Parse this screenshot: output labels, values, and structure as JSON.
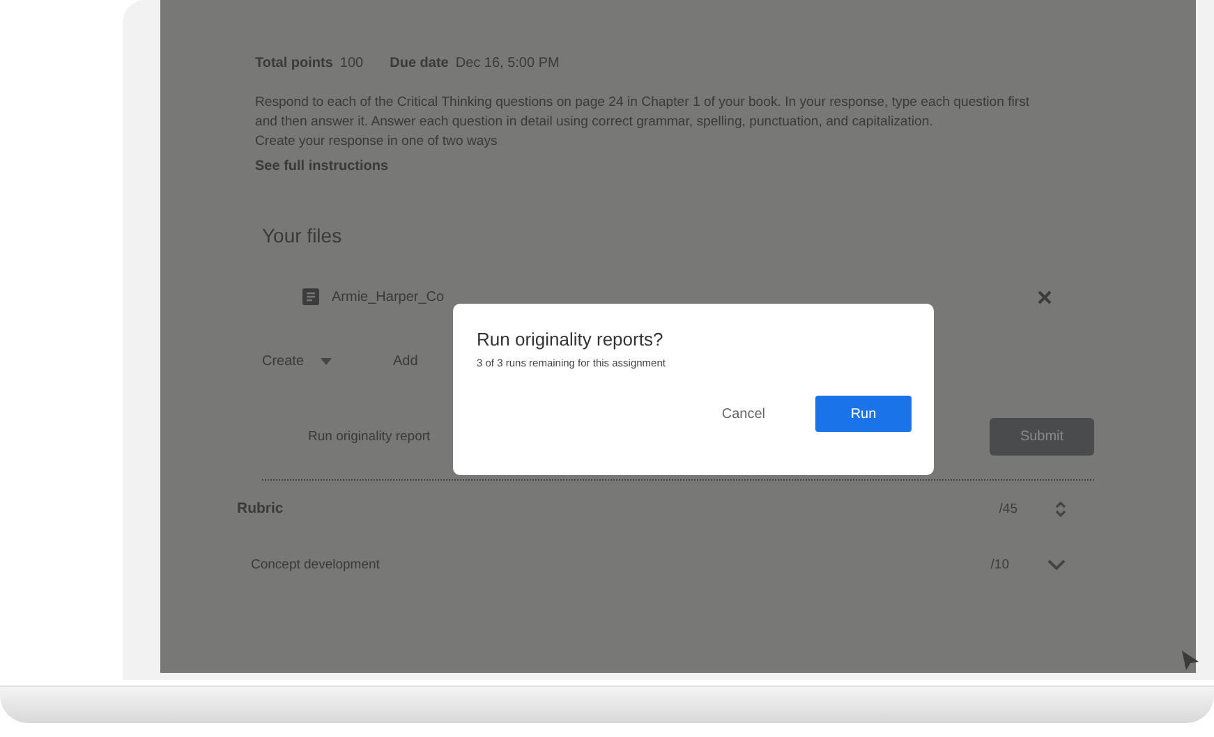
{
  "assignment": {
    "total_points_label": "Total points",
    "total_points": "100",
    "due_date_label": "Due date",
    "due_date": "Dec 16, 5:00 PM",
    "instructions": [
      "Respond to each of the Critical Thinking questions on page 24 in Chapter 1 of your book. In your response, type each question first",
      "and then answer it. Answer each question in detail using correct grammar, spelling, punctuation, and capitalization.",
      "Create your response in one of two ways"
    ],
    "see_full_instructions": "See full instructions"
  },
  "files": {
    "title": "Your files",
    "items": [
      {
        "name": "Armie_Harper_Co"
      }
    ],
    "create_button": "Create",
    "add_button": "Add",
    "originality_button": "Run originality report",
    "submit_button": "Submit"
  },
  "rubric": {
    "title": "Rubric",
    "total": "/45",
    "criteria": [
      {
        "name": "Concept development",
        "points": "/10",
        "expanded": false
      }
    ]
  },
  "dialog": {
    "title": "Run originality reports?",
    "message": "3 of 3 runs remaining for this assignment",
    "cancel_button": "Cancel",
    "run_button": "Run"
  }
}
